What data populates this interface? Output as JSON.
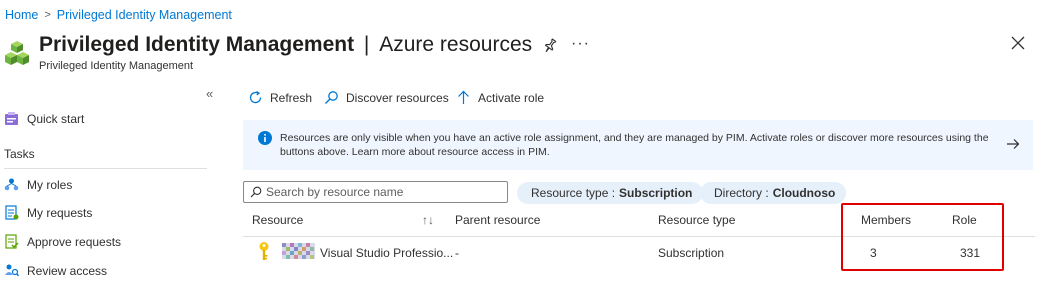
{
  "breadcrumb": {
    "items": [
      "Home",
      "Privileged Identity Management"
    ],
    "separator": ">"
  },
  "header": {
    "title": "Privileged Identity Management",
    "divider": "|",
    "section": "Azure resources",
    "subtitle": "Privileged Identity Management",
    "more": "···"
  },
  "sidebar": {
    "collapse": "«",
    "quick_start": "Quick start",
    "section_label": "Tasks",
    "items": [
      "My roles",
      "My requests",
      "Approve requests",
      "Review access"
    ]
  },
  "toolbar": {
    "refresh": "Refresh",
    "discover": "Discover resources",
    "activate": "Activate role"
  },
  "banner": {
    "text": "Resources are only visible when you have an active role assignment, and they are managed by PIM. Activate roles or discover more resources using the buttons above. Learn more about resource access in PIM."
  },
  "filters": {
    "search_placeholder": "Search by resource name",
    "resource_type_label": "Resource type :",
    "resource_type_value": "Subscription",
    "directory_label": "Directory :",
    "directory_value": "Cloudnoso"
  },
  "table": {
    "columns": [
      "Resource",
      "Parent resource",
      "Resource type",
      "Members",
      "Role"
    ],
    "sort_icon": "↑↓",
    "rows": [
      {
        "resource": "Visual Studio Professio...",
        "parent": "-",
        "type": "Subscription",
        "members": "3",
        "role": "331"
      }
    ]
  },
  "colors": {
    "accent": "#0078d4",
    "banner_bg": "#f0f6ff",
    "pill_bg": "#e5f0fb",
    "highlight": "#e00000"
  }
}
